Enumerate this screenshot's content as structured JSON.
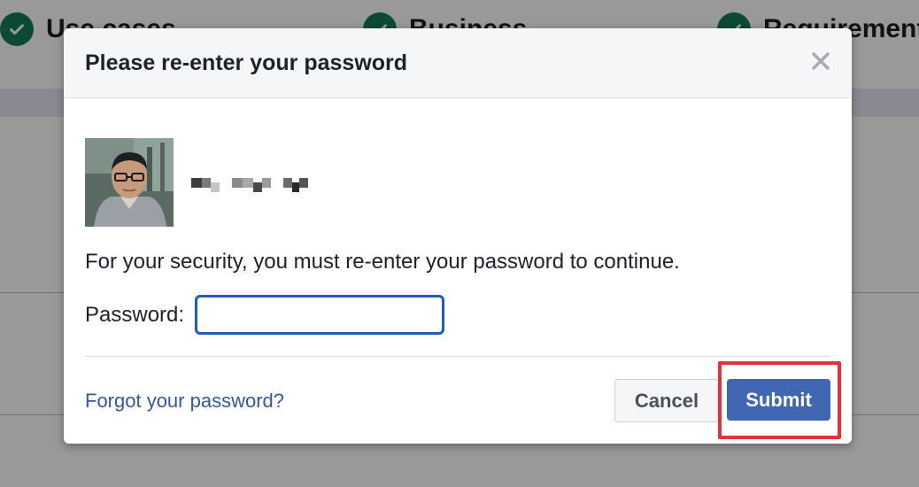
{
  "background": {
    "steps": [
      {
        "label": "Use cases"
      },
      {
        "label": "Business"
      },
      {
        "label": "Requirements"
      }
    ]
  },
  "dialog": {
    "title": "Please re-enter your password",
    "close_icon": "close-icon",
    "user": {
      "avatar_icon": "profile-photo",
      "name_obscured": true
    },
    "message": "For your security, you must re-enter your password to continue.",
    "password": {
      "label": "Password:",
      "value": "",
      "placeholder": ""
    },
    "forgot_link": "Forgot your password?",
    "cancel_label": "Cancel",
    "submit_label": "Submit"
  },
  "annotation": {
    "highlight_color": "#e8303a",
    "target": "submit-button"
  },
  "colors": {
    "primary": "#4267b2",
    "link": "#365899",
    "check_green": "#137c5a",
    "input_focus": "#1d5cc0"
  }
}
